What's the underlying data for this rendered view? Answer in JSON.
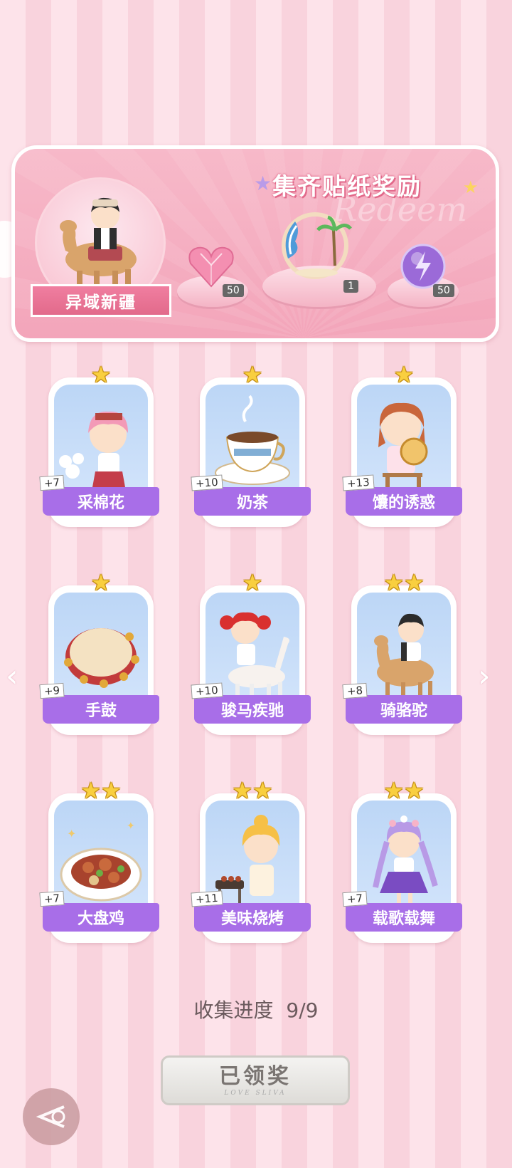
{
  "banner": {
    "title": "集齐贴纸奖励",
    "watermark": "Redeem",
    "portrait_label": "异域新疆",
    "rewards": [
      {
        "icon": "heart-gem-icon",
        "count": "50"
      },
      {
        "icon": "beach-frame-icon",
        "count": "1"
      },
      {
        "icon": "purple-orb-icon",
        "count": "50"
      }
    ]
  },
  "cards": [
    {
      "label": "采棉花",
      "plus": "+7",
      "stars": 1,
      "icon": "cotton-girl"
    },
    {
      "label": "奶茶",
      "plus": "+10",
      "stars": 1,
      "icon": "milk-tea"
    },
    {
      "label": "馕的诱惑",
      "plus": "+13",
      "stars": 1,
      "icon": "naan-girl"
    },
    {
      "label": "手鼓",
      "plus": "+9",
      "stars": 1,
      "icon": "hand-drum"
    },
    {
      "label": "骏马疾驰",
      "plus": "+10",
      "stars": 1,
      "icon": "horse-girl"
    },
    {
      "label": "骑骆驼",
      "plus": "+8",
      "stars": 2,
      "icon": "camel-boy"
    },
    {
      "label": "大盘鸡",
      "plus": "+7",
      "stars": 2,
      "icon": "chicken-dish"
    },
    {
      "label": "美味烧烤",
      "plus": "+11",
      "stars": 2,
      "icon": "bbq-girl"
    },
    {
      "label": "载歌载舞",
      "plus": "+7",
      "stars": 2,
      "icon": "dancing-girl"
    }
  ],
  "progress": {
    "label": "收集进度",
    "value": "9/9"
  },
  "claim_button": {
    "label": "已领奖",
    "subtitle": "LOVE SLIVA"
  },
  "colors": {
    "accent": "#a86ee8",
    "banner": "#f3a5ba",
    "star": "#f9cf3f"
  }
}
